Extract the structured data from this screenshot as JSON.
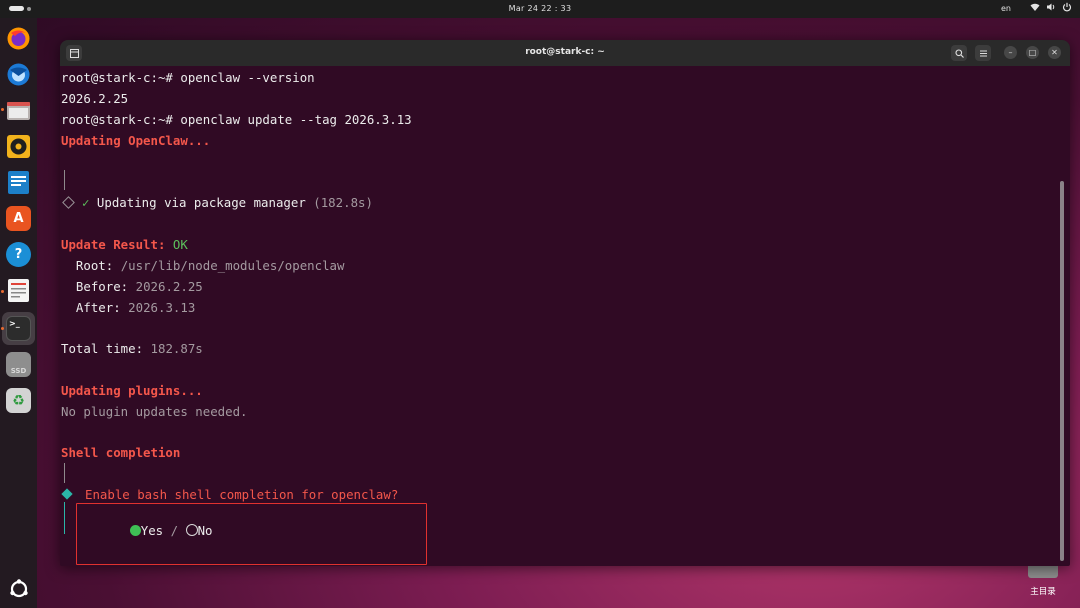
{
  "topbar": {
    "datetime": "Mar 24  22 : 33",
    "lang": "en",
    "network_icon": "wifi-icon",
    "volume_icon": "speaker-icon",
    "power_icon": "power-icon"
  },
  "dock": {
    "apps": [
      {
        "name": "firefox",
        "icon": "firefox-icon"
      },
      {
        "name": "thunderbird",
        "icon": "thunderbird-icon"
      },
      {
        "name": "files",
        "icon": "folder-icon"
      },
      {
        "name": "rhythmbox",
        "icon": "speaker-icon"
      },
      {
        "name": "libreoffice-writer",
        "icon": "document-icon"
      },
      {
        "name": "app-center",
        "icon": "app-store-icon",
        "glyph": "A"
      },
      {
        "name": "help",
        "icon": "help-icon",
        "glyph": "?"
      },
      {
        "name": "text-editor",
        "icon": "notepad-icon"
      },
      {
        "name": "terminal",
        "icon": "terminal-icon",
        "glyph": ">_"
      },
      {
        "name": "ssd",
        "icon": "drive-icon",
        "glyph": "SSD"
      },
      {
        "name": "trash",
        "icon": "trash-icon",
        "glyph": "♻"
      }
    ],
    "show_apps_icon": "ubuntu-icon"
  },
  "window": {
    "title": "root@stark-c: ~",
    "search_icon": "search-icon",
    "menu_icon": "hamburger-icon",
    "minimize": "–",
    "maximize": "□",
    "close": "✕"
  },
  "terminal": {
    "l1": "root@stark-c:~# openclaw --version",
    "l2": "2026.2.25",
    "l3": "root@stark-c:~# openclaw update --tag 2026.3.13",
    "l4": "Updating OpenClaw...",
    "l5_check": "✓",
    "l5_text": " Updating via package manager ",
    "l5_time": "(182.8s)",
    "result_label": "Update Result:",
    "result_value": "OK",
    "root_label": "  Root:",
    "root_value": "/usr/lib/node_modules/openclaw",
    "before_label": "  Before:",
    "before_value": "2026.2.25",
    "after_label": "  After:",
    "after_value": "2026.3.13",
    "total_label": "Total time:",
    "total_value": "182.87s",
    "plugins_header": "Updating plugins...",
    "plugins_msg": "No plugin updates needed.",
    "shell_header": "Shell completion",
    "question": "Enable bash shell completion for openclaw?",
    "opt_yes": "Yes",
    "separator": "/",
    "opt_no": "No"
  },
  "desktop": {
    "home_label": "主目录"
  }
}
